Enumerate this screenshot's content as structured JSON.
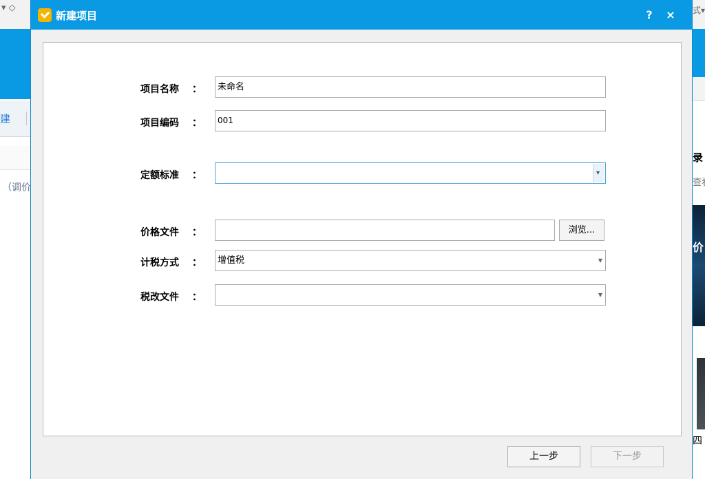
{
  "dialog": {
    "title": "新建项目",
    "help_label": "?",
    "close_label": "×"
  },
  "form": {
    "project_name": {
      "label": "项目名称",
      "colon": "：",
      "value": "未命名"
    },
    "project_code": {
      "label": "项目编码",
      "colon": "：",
      "value": "001"
    },
    "quota_standard": {
      "label": "定额标准",
      "colon": "：",
      "value": ""
    },
    "price_file": {
      "label": "价格文件",
      "colon": "：",
      "value": "",
      "browse_label": "浏览..."
    },
    "tax_method": {
      "label": "计税方式",
      "colon": "：",
      "value": "增值税"
    },
    "tax_reform_file": {
      "label": "税改文件",
      "colon": "：",
      "value": ""
    }
  },
  "footer": {
    "prev_label": "上一步",
    "next_label": "下一步"
  },
  "background": {
    "left_tab_fragment": "建",
    "left_text_fragment": "（调价",
    "left_top_glyphs": "▾ ◇",
    "right_top_glyph": "式▾",
    "right_heading_fragment": "录",
    "right_sub_fragment": "查看",
    "right_image_fragment": "价",
    "right_bottom_fragment": "四"
  },
  "colors": {
    "titlebar": "#0a9ae3",
    "panel_bg": "#ffffff",
    "dialog_bg": "#f0f0f0"
  }
}
